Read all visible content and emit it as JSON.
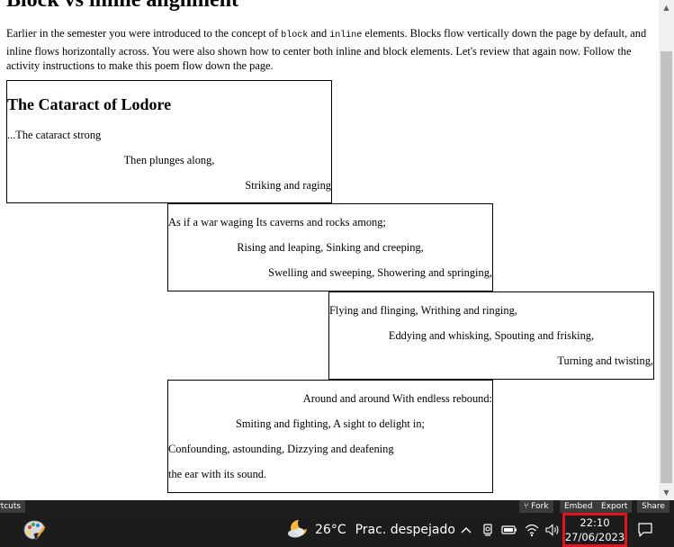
{
  "page": {
    "heading": "Block vs inline alignment",
    "intro": {
      "t1": "Earlier in the semester you were introduced to the concept of ",
      "code1": "block",
      "t2": " and ",
      "code2": "inline",
      "t3": " elements. Blocks flow vertically down the page by default, and inline flows horizontally across. You were also shown how to center both inline and block elements. Let's review that again now. Follow the activity instructions to make this poem flow down the page."
    },
    "poem": {
      "title": "The Cataract of Lodore",
      "stanza1": [
        "...The cataract strong",
        "Then plunges along,",
        "Striking and raging"
      ],
      "stanza2": [
        "As if a war waging Its caverns and rocks among;",
        "Rising and leaping, Sinking and creeping,",
        "Swelling and sweeping, Showering and springing,"
      ],
      "stanza3": [
        "Flying and flinging, Writhing and ringing,",
        "Eddying and whisking, Spouting and frisking,",
        "Turning and twisting,"
      ],
      "stanza4": [
        "Around and around With endless rebound:",
        "Smiting and fighting, A sight to delight in;",
        "Confounding, astounding, Dizzying and deafening",
        "the ear with its sound."
      ]
    }
  },
  "editor_bar": {
    "shortcuts": "rtcuts",
    "fork": "⑂ Fork",
    "embed": "Embed",
    "export": "Export",
    "share": "Share"
  },
  "taskbar": {
    "weather_temp": "26°C",
    "weather_condition": "Prac. despejado",
    "time": "22:10",
    "date": "27/06/2023",
    "chevron": "^",
    "highlight_color": "#e0141e"
  },
  "icons": [
    "paint-palette-app-icon",
    "moon-cloud-weather-icon",
    "chevron-up-icon",
    "meet-icon",
    "battery-icon",
    "wifi-icon",
    "volume-icon",
    "notification-icon"
  ]
}
